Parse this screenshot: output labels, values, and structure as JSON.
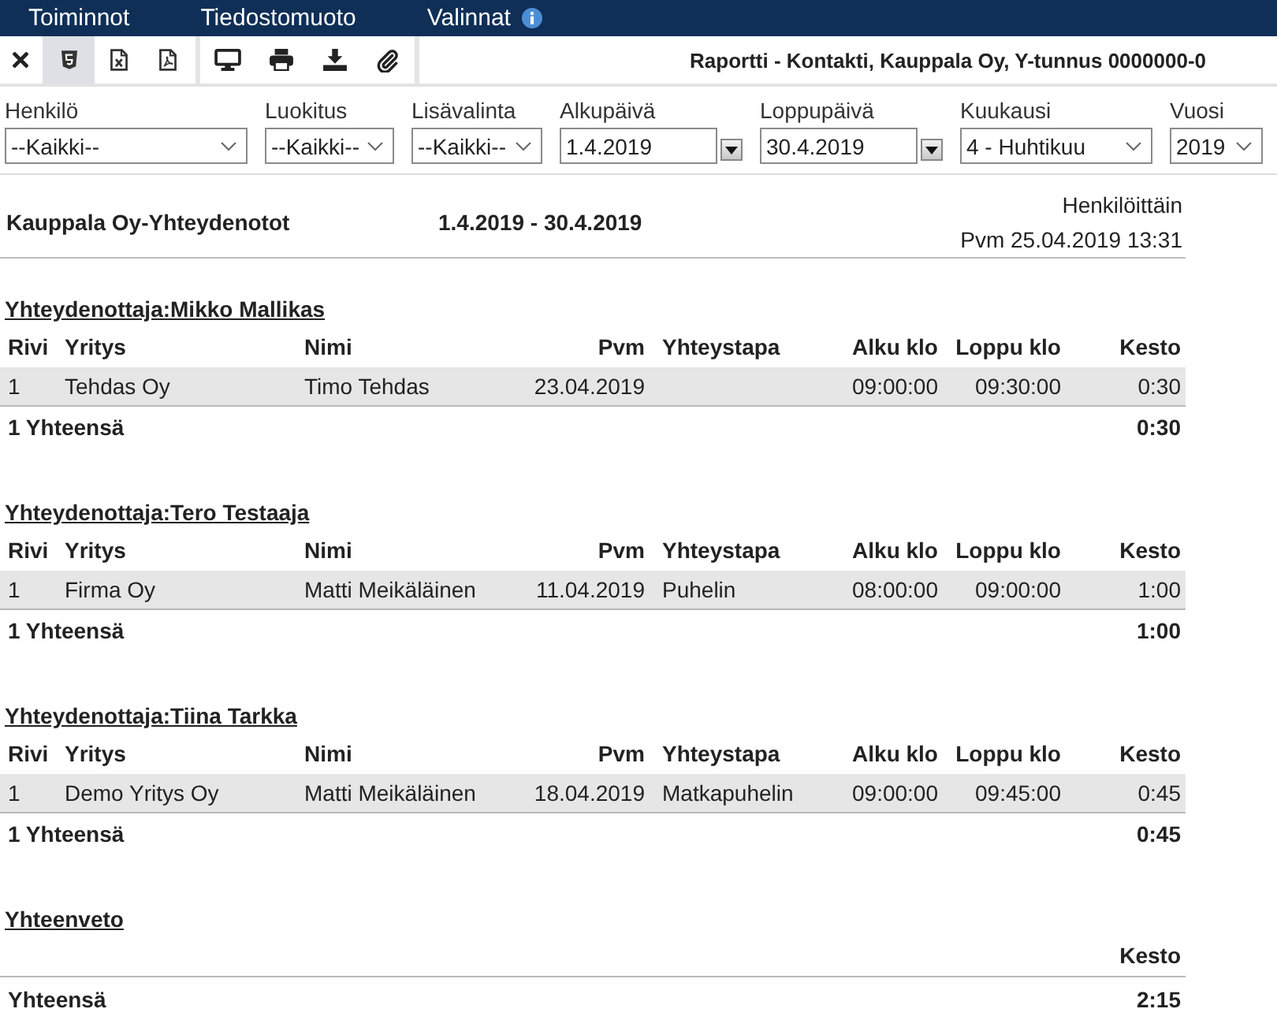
{
  "menu": [
    {
      "label": "Toiminnot",
      "info": false
    },
    {
      "label": "Tiedostomuoto",
      "info": false
    },
    {
      "label": "Valinnat",
      "info": true
    }
  ],
  "toolbar": {
    "groups": [
      {
        "buttons": [
          {
            "kind": "close",
            "selected": false
          },
          {
            "kind": "html",
            "selected": true
          },
          {
            "kind": "spreadsheet",
            "selected": false
          },
          {
            "kind": "pdf",
            "selected": false
          }
        ]
      },
      {
        "buttons": [
          {
            "kind": "screen",
            "selected": false
          },
          {
            "kind": "print",
            "selected": false
          },
          {
            "kind": "download",
            "selected": false
          },
          {
            "kind": "attachment",
            "selected": false
          }
        ]
      }
    ],
    "title": "Raportti - Kontakti, Kauppala Oy, Y-tunnus 0000000-0"
  },
  "filters": [
    {
      "label": "Henkilö",
      "kind": "select",
      "value": "--Kaikki--"
    },
    {
      "label": "Luokitus",
      "kind": "select",
      "value": "--Kaikki--"
    },
    {
      "label": "Lisävalinta",
      "kind": "select",
      "value": "--Kaikki--"
    },
    {
      "label": "Alkupäivä",
      "kind": "date",
      "value": "1.4.2019"
    },
    {
      "label": "Loppupäivä",
      "kind": "date",
      "value": "30.4.2019"
    },
    {
      "label": "Kuukausi",
      "kind": "select",
      "value": "4 - Huhtikuu"
    },
    {
      "label": "Vuosi",
      "kind": "select",
      "value": "2019"
    }
  ],
  "report": {
    "title": "Kauppala Oy-Yhteydenotot",
    "period": "1.4.2019 - 30.4.2019",
    "grouping": "Henkilöittäin",
    "printed": "Pvm 25.04.2019 13:31"
  },
  "sections": [
    {
      "heading": "Yhteydenottaja:Mikko Mallikas",
      "columns": [
        "Rivi",
        "Yritys",
        "Nimi",
        "Pvm",
        "Yhteystapa",
        "Alku klo",
        "Loppu klo",
        "Kesto"
      ],
      "rows": [
        {
          "rivi": "1",
          "yritys": "Tehdas Oy",
          "nimi": "Timo Tehdas",
          "pvm": "23.04.2019",
          "alku_klo": "09:00:00",
          "loppu_klo": "09:30:00",
          "kesto": "0:30"
        }
      ],
      "total_label": "1 Yhteensä",
      "total": "0:30"
    },
    {
      "heading": "Yhteydenottaja:Tero Testaaja",
      "columns": [
        "Rivi",
        "Yritys",
        "Nimi",
        "Pvm",
        "Yhteystapa",
        "Alku klo",
        "Loppu klo",
        "Kesto"
      ],
      "rows": [
        {
          "rivi": "1",
          "yritys": "Firma Oy",
          "nimi": "Matti Meikäläinen",
          "pvm": "11.04.2019",
          "yhteystapa": "Puhelin",
          "alku_klo": "08:00:00",
          "loppu_klo": "09:00:00",
          "kesto": "1:00"
        }
      ],
      "total_label": "1 Yhteensä",
      "total": "1:00"
    },
    {
      "heading": "Yhteydenottaja:Tiina Tarkka",
      "columns": [
        "Rivi",
        "Yritys",
        "Nimi",
        "Pvm",
        "Yhteystapa",
        "Alku klo",
        "Loppu klo",
        "Kesto"
      ],
      "rows": [
        {
          "rivi": "1",
          "yritys": "Demo Yritys Oy",
          "nimi": "Matti Meikäläinen",
          "pvm": "18.04.2019",
          "yhteystapa": "Matkapuhelin",
          "alku_klo": "09:00:00",
          "loppu_klo": "09:45:00",
          "kesto": "0:45"
        }
      ],
      "total_label": "1 Yhteensä",
      "total": "0:45"
    }
  ],
  "summary": {
    "heading": "Yhteenveto",
    "column": "Kesto",
    "total_label": "Yhteensä",
    "total": "2:15"
  }
}
